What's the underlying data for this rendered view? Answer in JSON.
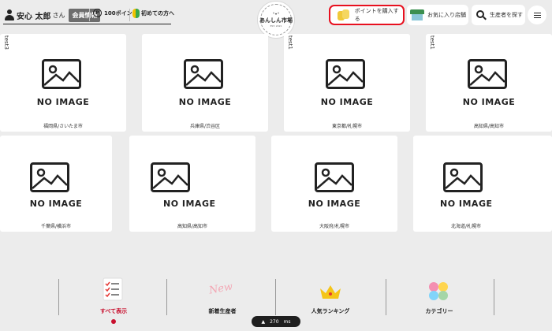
{
  "header": {
    "user_name": "安心 太郎",
    "user_honorific": "さん",
    "member_badge": "会員情報",
    "points_label": "100ポイント",
    "points_symbol": "P",
    "beginner_label": "初めての方へ",
    "logo": {
      "name": "あんしん市場",
      "mark": "ᐡ•ᐡ",
      "est": "EST. 2021"
    },
    "buy_points_label": "ポイントを購入する",
    "favorites_label": "お気に入り店舗",
    "search_producers_label": "生産者を探す"
  },
  "cards_row1": [
    {
      "tag": "test3",
      "no_image": "NO IMAGE",
      "location": "福岡県/さいたま市"
    },
    {
      "tag": "",
      "no_image": "NO IMAGE",
      "location": "兵庫県/渋谷区"
    },
    {
      "tag": "test1",
      "no_image": "NO IMAGE",
      "location": "東京都/札幌市"
    },
    {
      "tag": "test1",
      "no_image": "NO IMAGE",
      "location": "高知県/高知市"
    }
  ],
  "cards_row2": [
    {
      "no_image": "NO IMAGE",
      "location": "千葉県/横浜市"
    },
    {
      "no_image": "NO IMAGE",
      "location": "高知県/高知市"
    },
    {
      "no_image": "NO IMAGE",
      "location": "大阪府/札幌市"
    },
    {
      "no_image": "NO IMAGE",
      "location": "北海道/札幌市"
    }
  ],
  "bottom_nav": {
    "all": "すべて表示",
    "new_producers": "新着生産者",
    "ranking": "人気ランキング",
    "category": "カテゴリー",
    "new_badge": "New"
  },
  "zoom_pill": {
    "value": "270",
    "unit": "ms"
  },
  "colors": {
    "accent_red": "#e8101f",
    "active_nav": "#c8102e",
    "background": "#ececec"
  }
}
